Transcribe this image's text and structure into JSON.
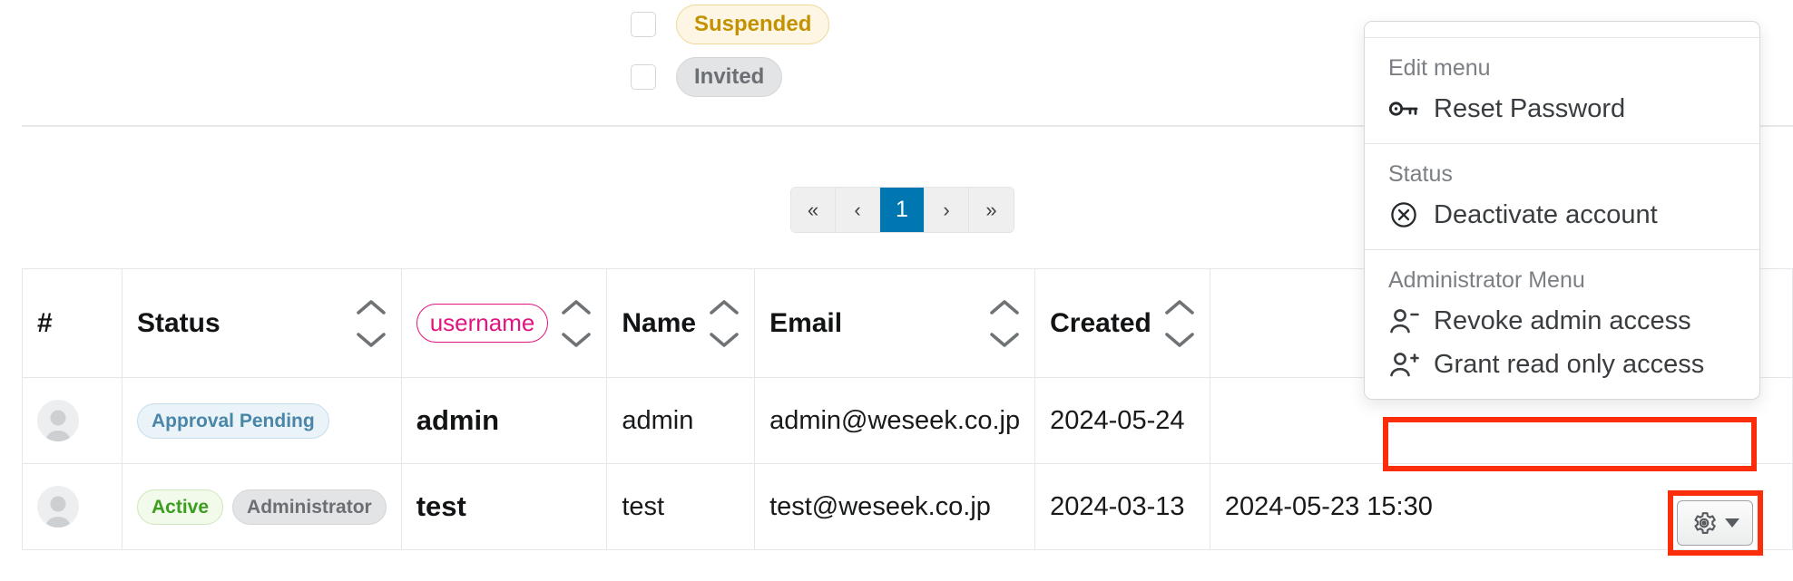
{
  "filters": [
    {
      "label": "Suspended",
      "checked": false,
      "style": "suspended"
    },
    {
      "label": "Invited",
      "checked": false,
      "style": "invited"
    }
  ],
  "pagination": {
    "first_label": "«",
    "prev_label": "‹",
    "next_label": "›",
    "last_label": "»",
    "pages": [
      "1"
    ],
    "current_page": "1"
  },
  "table": {
    "columns": [
      {
        "key": "index",
        "label": "#",
        "sortable": false,
        "code": false
      },
      {
        "key": "status",
        "label": "Status",
        "sortable": true,
        "code": false
      },
      {
        "key": "username",
        "label": "username",
        "sortable": true,
        "code": true
      },
      {
        "key": "name",
        "label": "Name",
        "sortable": true,
        "code": false
      },
      {
        "key": "email",
        "label": "Email",
        "sortable": true,
        "code": false
      },
      {
        "key": "created",
        "label": "Created",
        "sortable": true,
        "code": false
      }
    ],
    "rows": [
      {
        "avatar": "user-placeholder",
        "badges": [
          {
            "label": "Approval Pending",
            "style": "pending"
          }
        ],
        "username": "admin",
        "name": "admin",
        "email": "admin@weseek.co.jp",
        "created": "2024-05-24",
        "last_login": ""
      },
      {
        "avatar": "user-placeholder",
        "badges": [
          {
            "label": "Active",
            "style": "active"
          },
          {
            "label": "Administrator",
            "style": "admin"
          }
        ],
        "username": "test",
        "name": "test",
        "email": "test@weseek.co.jp",
        "created": "2024-03-13",
        "last_login": "2024-05-23 15:30"
      }
    ]
  },
  "dropdown": {
    "sections": [
      {
        "header": "Edit menu",
        "items": [
          {
            "label": "Reset Password",
            "icon": "key-icon",
            "highlighted": false
          }
        ]
      },
      {
        "header": "Status",
        "items": [
          {
            "label": "Deactivate account",
            "icon": "circle-x-icon",
            "highlighted": false
          }
        ]
      },
      {
        "header": "Administrator Menu",
        "items": [
          {
            "label": "Revoke admin access",
            "icon": "user-minus-icon",
            "highlighted": false
          },
          {
            "label": "Grant read only access",
            "icon": "user-plus-icon",
            "highlighted": true
          }
        ]
      }
    ]
  },
  "row_action_button": {
    "icon": "gear-icon",
    "caret": "chevron-down-icon"
  },
  "colors": {
    "accent_blue": "#0077b0",
    "highlight_red": "#fc2d0b",
    "code_pink": "#e3147e",
    "suspended_gold": "#c49200",
    "active_green": "#3b9e1e",
    "pending_blue": "#4a86a8",
    "muted_gray": "#6b6f73"
  }
}
